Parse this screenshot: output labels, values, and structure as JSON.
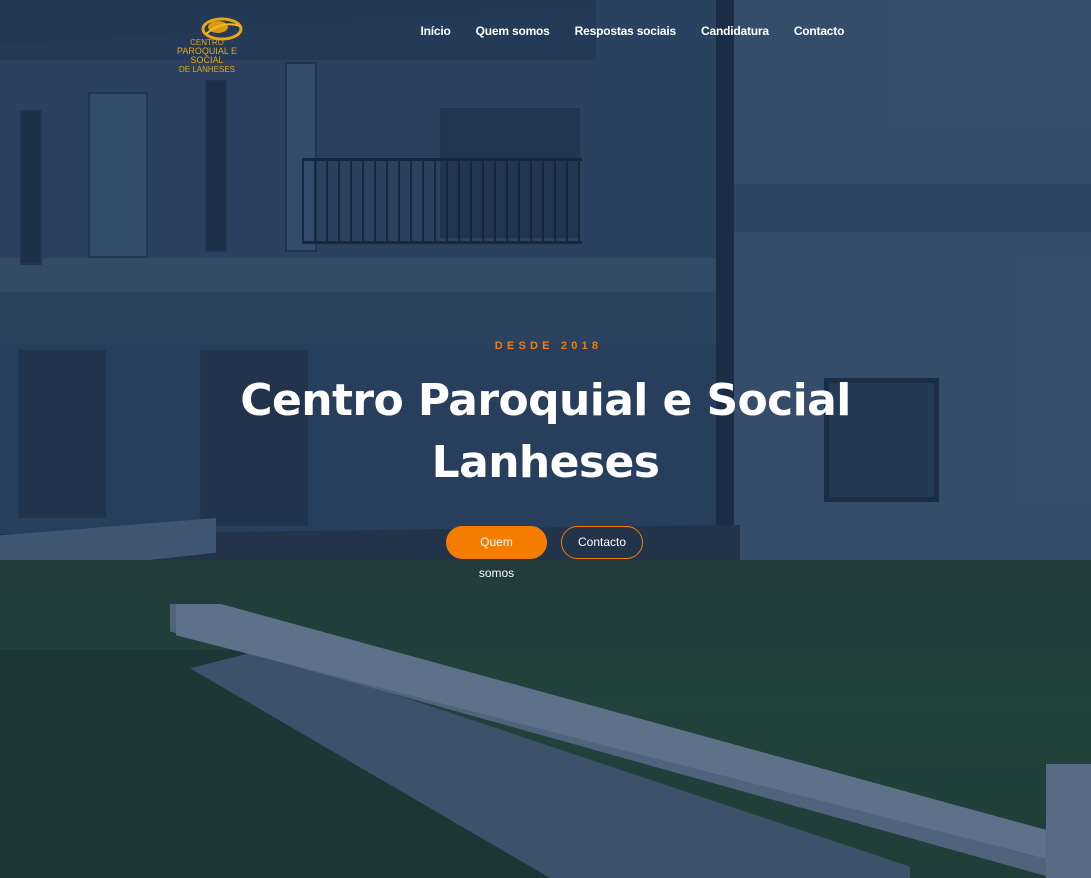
{
  "logo": {
    "line1": "CENTRO",
    "line2": "PAROQUIAL E SOCIAL",
    "line3": "DE LANHESES",
    "color": "#e5a716"
  },
  "nav": {
    "items": [
      {
        "label": "Início"
      },
      {
        "label": "Quem somos"
      },
      {
        "label": "Respostas sociais"
      },
      {
        "label": "Candidatura"
      },
      {
        "label": "Contacto"
      }
    ]
  },
  "hero": {
    "eyebrow": "DESDE 2018",
    "title_line1": "Centro Paroquial e Social",
    "title_line2": "Lanheses",
    "primary_button": "Quem somos",
    "secondary_button": "Contacto"
  },
  "colors": {
    "accent": "#f47d00",
    "overlay": "#162848",
    "text": "#ffffff"
  }
}
